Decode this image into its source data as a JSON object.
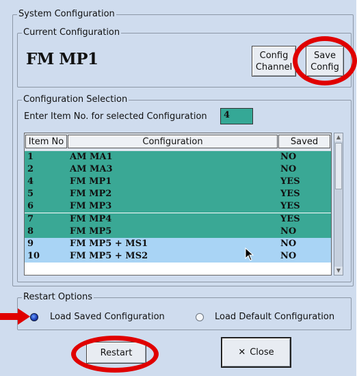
{
  "system": {
    "title": "System Configuration"
  },
  "current": {
    "title": "Current Configuration",
    "name": "FM MP1",
    "config_channel_line1": "Config",
    "config_channel_line2": "Channel",
    "save_config_line1": "Save",
    "save_config_line2": "Config"
  },
  "selection": {
    "title": "Configuration Selection",
    "prompt": "Enter Item No. for selected Configuration",
    "item_value": "4",
    "headers": {
      "item": "Item No",
      "config": "Configuration",
      "saved": "Saved"
    },
    "rows": [
      {
        "item": "1",
        "config": "AM MA1",
        "saved": "NO",
        "color": "#3aa895"
      },
      {
        "item": "2",
        "config": "AM MA3",
        "saved": "NO",
        "color": "#3aa895"
      },
      {
        "item": "4",
        "config": "FM MP1",
        "saved": "YES",
        "color": "#3aa895"
      },
      {
        "item": "5",
        "config": "FM MP2",
        "saved": "YES",
        "color": "#3aa895"
      },
      {
        "item": "6",
        "config": "FM MP3",
        "saved": "YES",
        "color": "#3aa895"
      },
      {
        "item": "7",
        "config": "FM MP4",
        "saved": "YES",
        "color": "#3aa895"
      },
      {
        "item": "8",
        "config": "FM MP5",
        "saved": "NO",
        "color": "#3aa895"
      },
      {
        "item": "9",
        "config": "FM MP5 + MS1",
        "saved": "NO",
        "color": "#a9d4f5"
      },
      {
        "item": "10",
        "config": "FM MP5 + MS2",
        "saved": "NO",
        "color": "#a9d4f5"
      }
    ]
  },
  "restart_options": {
    "title": "Restart Options",
    "load_saved": "Load Saved Configuration",
    "load_default": "Load Default Configuration",
    "selected": "Load Saved Configuration"
  },
  "buttons": {
    "restart": "Restart",
    "close": "Close"
  },
  "colors": {
    "highlight_ring": "#e00000",
    "window_bg": "#cfdcee",
    "row_saved": "#3aa895",
    "row_unsaved": "#a9d4f5"
  }
}
